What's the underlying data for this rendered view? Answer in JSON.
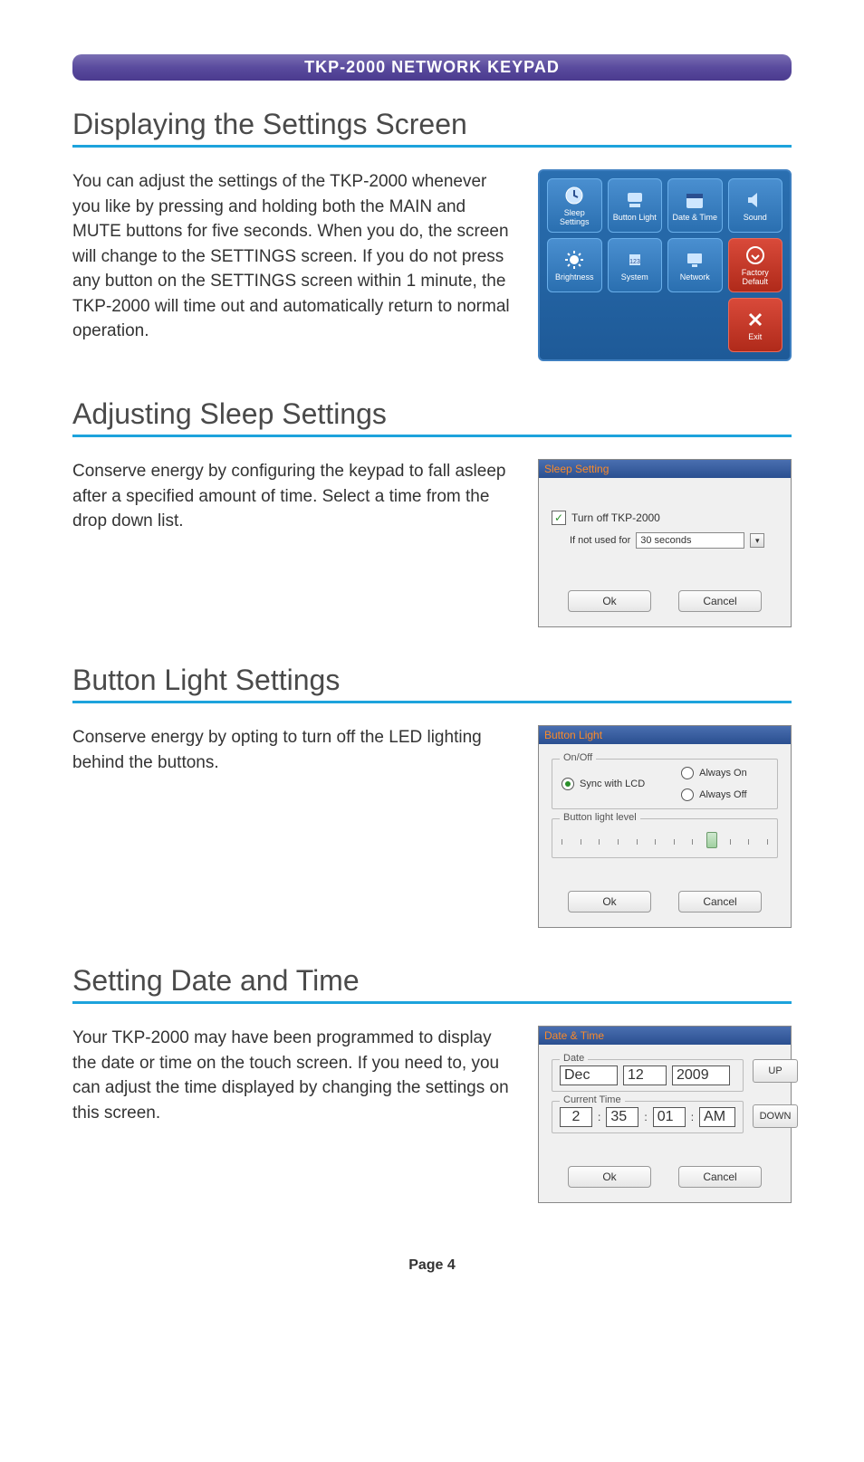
{
  "banner": "TKP-2000 NETWORK KEYPAD",
  "page_label": "Page 4",
  "sections": {
    "display": {
      "title": "Displaying the Settings Screen",
      "body": "You can adjust the settings of the TKP-2000 whenever you like by pressing and holding both the MAIN and MUTE buttons for five seconds. When you do, the screen will change to the SETTINGS screen. If you do not press any button on the SETTINGS screen within 1 minute, the TKP-2000 will time out and automatically return to normal operation."
    },
    "sleep": {
      "title": "Adjusting Sleep Settings",
      "body": "Conserve energy by configuring the keypad to fall asleep after a specified amount of time. Select a time from the drop down list."
    },
    "button_light": {
      "title": "Button Light Settings",
      "body": "Conserve energy by opting to turn off the LED lighting behind the buttons."
    },
    "datetime": {
      "title": "Setting Date and Time",
      "body": "Your TKP-2000 may have been programmed to display the date or time on the touch screen. If you need to, you can adjust the time displayed by changing the settings on this screen."
    }
  },
  "settings_tiles": {
    "sleep": "Sleep Settings",
    "button": "Button Light",
    "date": "Date & Time",
    "sound": "Sound",
    "brightness": "Brightness",
    "system": "System",
    "network": "Network",
    "factory": "Factory Default",
    "exit": "Exit"
  },
  "sleep_dialog": {
    "title": "Sleep Setting",
    "checkbox": "Turn off TKP-2000",
    "if_not_used": "If not used for",
    "duration": "30 seconds",
    "ok": "Ok",
    "cancel": "Cancel"
  },
  "button_dialog": {
    "title": "Button Light",
    "onoff_label": "On/Off",
    "sync": "Sync with LCD",
    "always_on": "Always On",
    "always_off": "Always Off",
    "level_label": "Button light level",
    "ok": "Ok",
    "cancel": "Cancel",
    "slider_value": 8,
    "slider_max": 11
  },
  "date_dialog": {
    "title": "Date & Time",
    "date_label": "Date",
    "time_label": "Current Time",
    "month": "Dec",
    "day": "12",
    "year": "2009",
    "hour": "2",
    "minute": "35",
    "second": "01",
    "ampm": "AM",
    "up": "UP",
    "down": "DOWN",
    "ok": "Ok",
    "cancel": "Cancel"
  }
}
